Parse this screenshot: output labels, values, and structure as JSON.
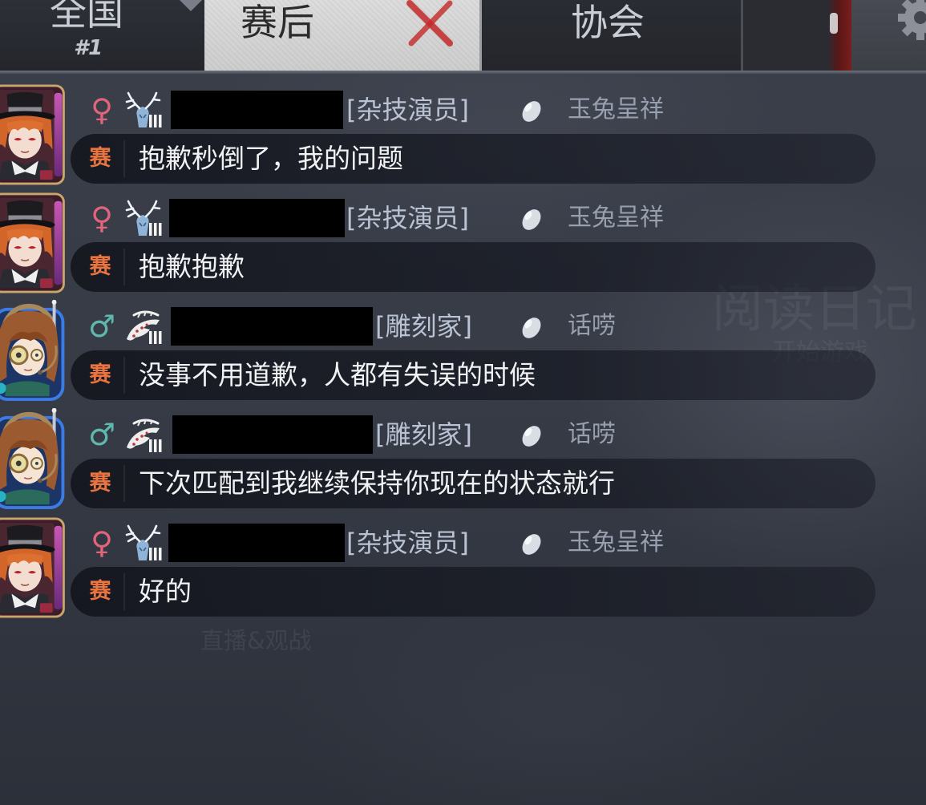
{
  "tabs": {
    "national": {
      "label": "全国",
      "rank": "#1"
    },
    "post_match": {
      "label": "赛后",
      "selected": true
    },
    "association": {
      "label": "协会"
    }
  },
  "background_menu": {
    "diary": "阅读日记",
    "start_game": "开始游戏",
    "live_spectate": "直播&观战"
  },
  "messages": [
    {
      "avatar": "hat-gentleman-avatar",
      "gender": "♀",
      "rank_icon": "antler-rank-icon",
      "role": "[杂技演员]",
      "title": "玉兔呈祥",
      "channel": "赛",
      "text": "抱歉秒倒了，我的问题"
    },
    {
      "avatar": "hat-gentleman-avatar",
      "gender": "♀",
      "rank_icon": "antler-rank-icon",
      "role": "[杂技演员]",
      "title": "玉兔呈祥",
      "channel": "赛",
      "text": "抱歉抱歉"
    },
    {
      "avatar": "goggles-girl-avatar",
      "gender": "♂",
      "rank_icon": "serpent-rank-icon",
      "role": "[雕刻家]",
      "title": "话唠",
      "channel": "赛",
      "text": "没事不用道歉，人都有失误的时候"
    },
    {
      "avatar": "goggles-girl-avatar",
      "gender": "♂",
      "rank_icon": "serpent-rank-icon",
      "role": "[雕刻家]",
      "title": "话唠",
      "channel": "赛",
      "text": "下次匹配到我继续保持你现在的状态就行"
    },
    {
      "avatar": "hat-gentleman-avatar",
      "gender": "♀",
      "rank_icon": "antler-rank-icon",
      "role": "[杂技演员]",
      "title": "玉兔呈祥",
      "channel": "赛",
      "text": "好的"
    }
  ],
  "colors": {
    "female": "#e0647c",
    "male": "#5fb8ae",
    "channel_tag": "#ea7440",
    "role_text": "#bac3d4",
    "title_text": "#98a0b0",
    "selected_tab": "#d6d6d6",
    "x_mark": "#c42a2a"
  }
}
